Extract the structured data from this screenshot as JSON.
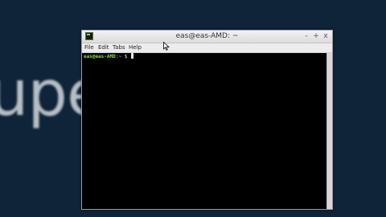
{
  "background": {
    "text": "upe        ut"
  },
  "window": {
    "title": "eas@eas-AMD: ~",
    "buttons": {
      "minimize": "-",
      "maximize": "+",
      "close": "x"
    }
  },
  "menu": {
    "items": [
      "File",
      "Edit",
      "Tabs",
      "Help"
    ]
  },
  "terminal": {
    "prompt_user": "eas@eas-AMD",
    "prompt_path": ":~ $"
  },
  "colors": {
    "prompt": "#8ae234",
    "terminal_bg": "#000000",
    "desktop_bg": "#0f2438"
  }
}
